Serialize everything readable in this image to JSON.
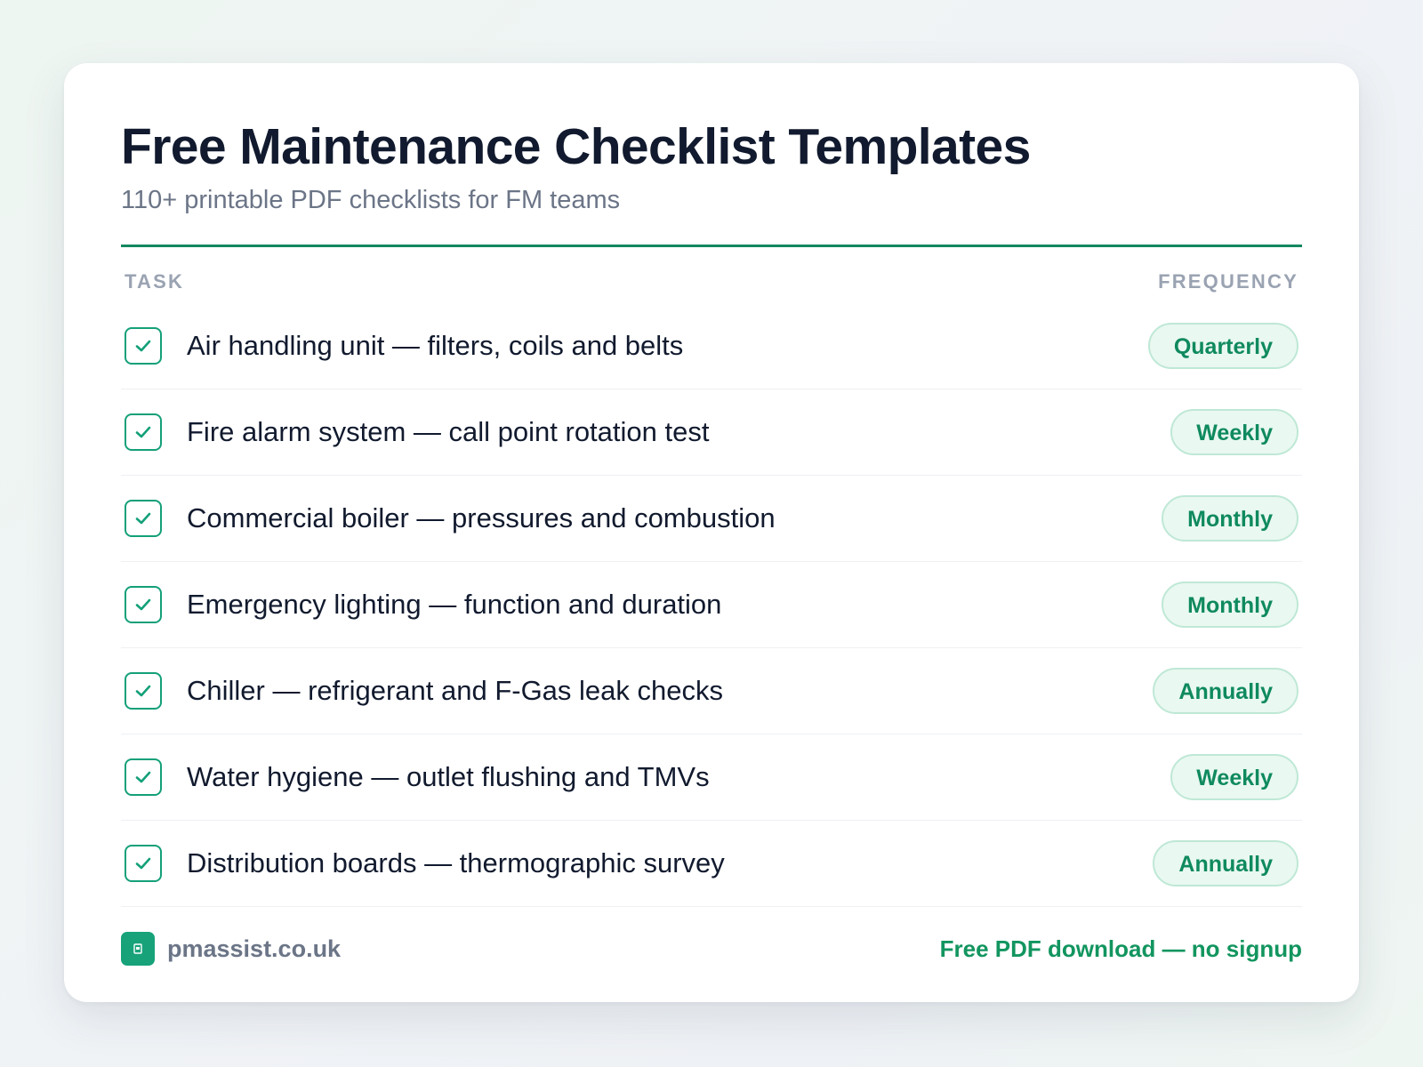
{
  "header": {
    "title": "Free Maintenance Checklist Templates",
    "subtitle": "110+ printable PDF checklists for FM teams"
  },
  "table": {
    "col_task": "TASK",
    "col_frequency": "FREQUENCY",
    "rows": [
      {
        "task": "Air handling unit — filters, coils and belts",
        "frequency": "Quarterly",
        "checked": true
      },
      {
        "task": "Fire alarm system — call point rotation test",
        "frequency": "Weekly",
        "checked": true
      },
      {
        "task": "Commercial boiler — pressures and combustion",
        "frequency": "Monthly",
        "checked": true
      },
      {
        "task": "Emergency lighting — function and duration",
        "frequency": "Monthly",
        "checked": true
      },
      {
        "task": "Chiller — refrigerant and F-Gas leak checks",
        "frequency": "Annually",
        "checked": true
      },
      {
        "task": "Water hygiene — outlet flushing and TMVs",
        "frequency": "Weekly",
        "checked": true
      },
      {
        "task": "Distribution boards — thermographic survey",
        "frequency": "Annually",
        "checked": true
      }
    ]
  },
  "footer": {
    "brand": "pmassist.co.uk",
    "brand_icon": "building-icon",
    "cta": "Free PDF download — no signup"
  },
  "colors": {
    "accent": "#12875f",
    "pill_bg": "#e9f8f1",
    "pill_border": "#bfe8d6",
    "pill_text": "#0f8a5e",
    "title": "#111a2e",
    "muted": "#6b7587"
  }
}
